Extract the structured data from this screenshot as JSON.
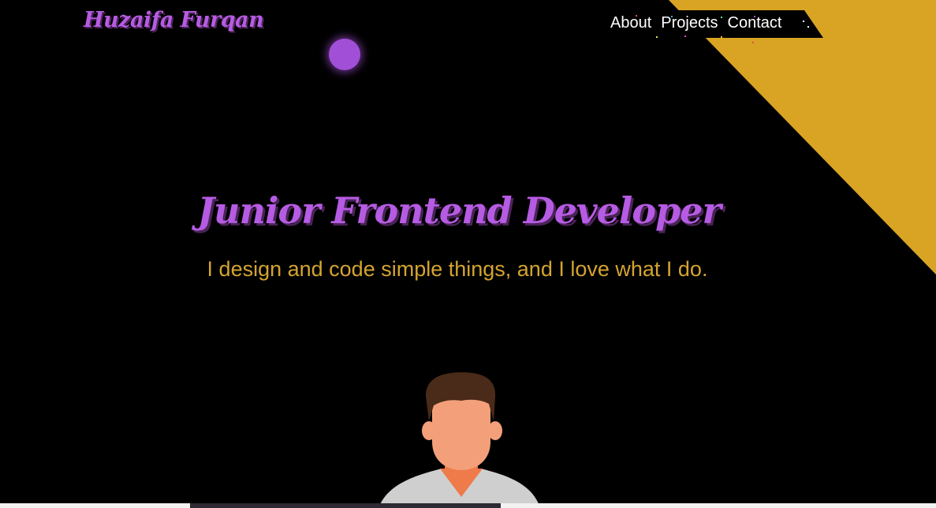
{
  "logo": {
    "text": "Huzaifa Furqan"
  },
  "nav": {
    "items": [
      "About",
      "Projects",
      "Contact"
    ]
  },
  "hero": {
    "title": "Junior Frontend Developer",
    "subtitle": "I design and code simple things, and I love what I do."
  },
  "colors": {
    "background": "#000000",
    "accent_purple": "#b65be3",
    "accent_gold": "#d9a424",
    "subtitle_gold": "#d4a431",
    "nav_text": "#ffffff"
  },
  "icons": {
    "orb": "purple-glow-orb",
    "avatar": "developer-avatar-illustration"
  },
  "scroll": {
    "position_fraction": 0.2
  }
}
